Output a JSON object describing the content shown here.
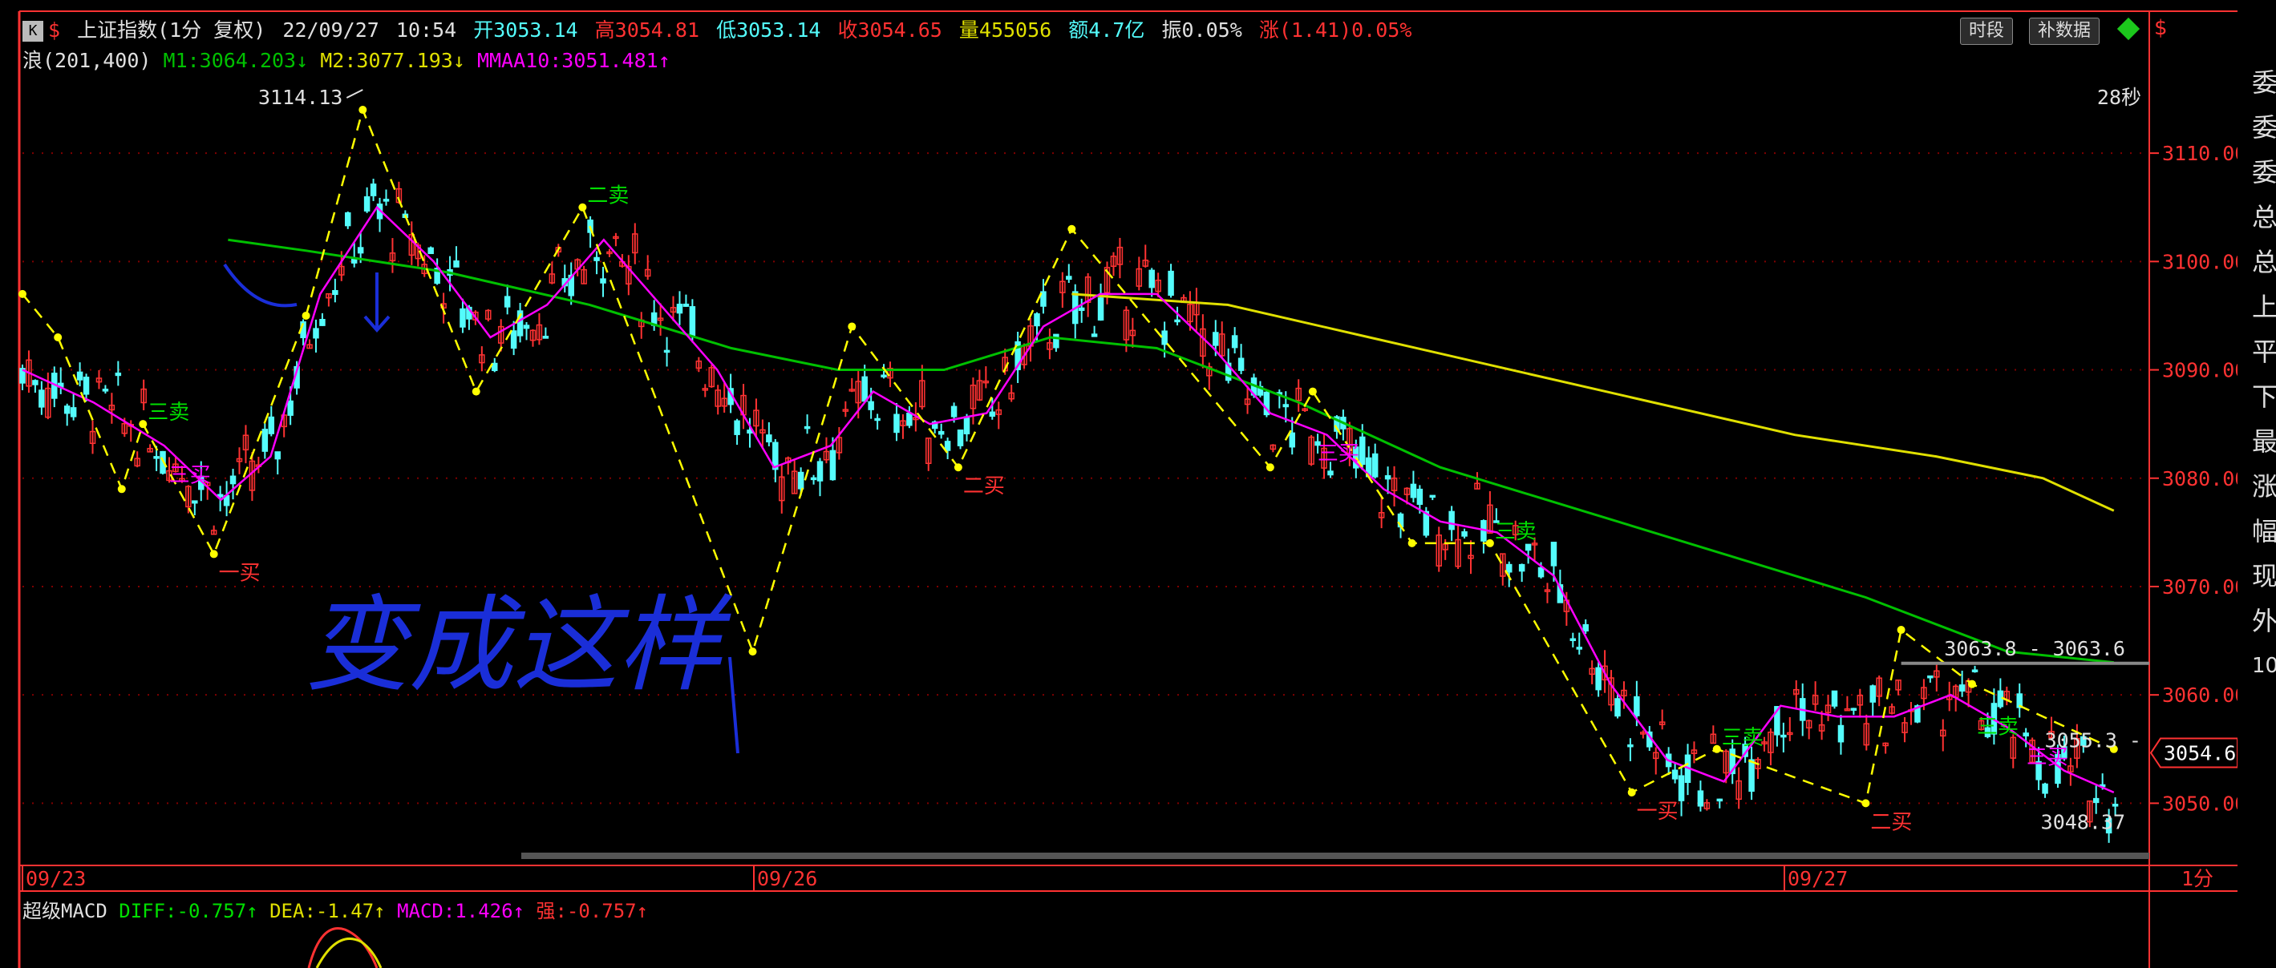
{
  "header": {
    "k_label": "K",
    "dollar": "$",
    "title": "上证指数(1分 复权)",
    "date": "22/09/27",
    "time": "10:54",
    "open": "开3053.14",
    "high": "高3054.81",
    "low": "低3053.14",
    "close": "收3054.65",
    "volume": "量455056",
    "amount": "额4.7亿",
    "amplitude": "振0.05%",
    "change": "涨(1.41)0.05%",
    "btn_period": "时段",
    "btn_fill": "补数据"
  },
  "indicators": {
    "wave": "浪(201,400)",
    "m1": "M1:3064.203",
    "m2": "M2:3077.193",
    "mmaa": "MMAA10:3051.481"
  },
  "macd": {
    "name": "超级MACD",
    "diff": "DIFF:-0.757",
    "dea": "DEA:-1.47",
    "macd": "MACD:1.426",
    "strong": "强:-0.757"
  },
  "right_panel_chars": [
    "委",
    "委",
    "委",
    "总",
    "总",
    "上",
    "平",
    "下",
    "最",
    "涨",
    "幅",
    "现",
    "外",
    "10"
  ],
  "chart_data": {
    "type": "line",
    "title": "上证指数(1分 复权)",
    "interval": "1分",
    "x_labels": [
      "09/23",
      "09/26",
      "09/27"
    ],
    "y_ticks": [
      3050,
      3060,
      3070,
      3080,
      3090,
      3100,
      3110
    ],
    "y_tick_labels": [
      "3050.00",
      "3060.00",
      "3070.00",
      "3080.00",
      "3090.00",
      "3100.00",
      "3110.00"
    ],
    "ylim": [
      3045,
      3116
    ],
    "last_price": 3054.65,
    "last_price_label": "3054.65",
    "timer": "28秒",
    "annotations": {
      "high_label": "3114.13",
      "low_label": "3048.37",
      "right_high": "3063.8 - 3063.6",
      "right_mid": "3055.3 -",
      "handwriting": "变成这样"
    },
    "wave_points": [
      {
        "x": 0,
        "y": 3097
      },
      {
        "x": 5,
        "y": 3093
      },
      {
        "x": 14,
        "y": 3079
      },
      {
        "x": 17,
        "y": 3085
      },
      {
        "x": 27,
        "y": 3073
      },
      {
        "x": 40,
        "y": 3095
      },
      {
        "x": 48,
        "y": 3114
      },
      {
        "x": 64,
        "y": 3088
      },
      {
        "x": 79,
        "y": 3105
      },
      {
        "x": 103,
        "y": 3064
      },
      {
        "x": 117,
        "y": 3094
      },
      {
        "x": 132,
        "y": 3081
      },
      {
        "x": 148,
        "y": 3103
      },
      {
        "x": 176,
        "y": 3081
      },
      {
        "x": 182,
        "y": 3088
      },
      {
        "x": 196,
        "y": 3074
      },
      {
        "x": 207,
        "y": 3074
      },
      {
        "x": 227,
        "y": 3051
      },
      {
        "x": 239,
        "y": 3055
      },
      {
        "x": 260,
        "y": 3050
      },
      {
        "x": 265,
        "y": 3066
      },
      {
        "x": 275,
        "y": 3061
      },
      {
        "x": 295,
        "y": 3055
      }
    ],
    "signals": [
      {
        "x": 17,
        "y": 3085,
        "text": "三卖"
      },
      {
        "x": 20,
        "y": 3082,
        "text": "三买"
      },
      {
        "x": 27,
        "y": 3073,
        "text": "一买"
      },
      {
        "x": 79,
        "y": 3105,
        "text": "二卖"
      },
      {
        "x": 132,
        "y": 3081,
        "text": "二买"
      },
      {
        "x": 182,
        "y": 3084,
        "text": "三买"
      },
      {
        "x": 207,
        "y": 3074,
        "text": "三卖"
      },
      {
        "x": 227,
        "y": 3051,
        "text": "一买"
      },
      {
        "x": 239,
        "y": 3055,
        "text": "三卖"
      },
      {
        "x": 260,
        "y": 3050,
        "text": "二买"
      },
      {
        "x": 275,
        "y": 3056,
        "text": "三卖"
      },
      {
        "x": 282,
        "y": 3056,
        "text": "三买"
      }
    ],
    "m1_series": [
      [
        29,
        3102
      ],
      [
        40,
        3101
      ],
      [
        60,
        3099
      ],
      [
        80,
        3096
      ],
      [
        100,
        3092
      ],
      [
        115,
        3090
      ],
      [
        130,
        3090
      ],
      [
        145,
        3093
      ],
      [
        160,
        3092
      ],
      [
        180,
        3087
      ],
      [
        200,
        3081
      ],
      [
        220,
        3077
      ],
      [
        240,
        3073
      ],
      [
        260,
        3069
      ],
      [
        280,
        3064
      ],
      [
        295,
        3063
      ]
    ],
    "m2_series": [
      [
        148,
        3097
      ],
      [
        170,
        3096
      ],
      [
        190,
        3093
      ],
      [
        210,
        3090
      ],
      [
        230,
        3087
      ],
      [
        250,
        3084
      ],
      [
        270,
        3082
      ],
      [
        285,
        3080
      ],
      [
        295,
        3077
      ]
    ],
    "mmaa_series": [
      [
        0,
        3090
      ],
      [
        10,
        3087
      ],
      [
        20,
        3083
      ],
      [
        28,
        3078
      ],
      [
        35,
        3082
      ],
      [
        42,
        3097
      ],
      [
        50,
        3105
      ],
      [
        58,
        3100
      ],
      [
        66,
        3093
      ],
      [
        74,
        3096
      ],
      [
        82,
        3102
      ],
      [
        90,
        3096
      ],
      [
        98,
        3090
      ],
      [
        106,
        3081
      ],
      [
        114,
        3083
      ],
      [
        120,
        3088
      ],
      [
        128,
        3085
      ],
      [
        136,
        3086
      ],
      [
        144,
        3094
      ],
      [
        152,
        3097
      ],
      [
        160,
        3097
      ],
      [
        168,
        3092
      ],
      [
        176,
        3086
      ],
      [
        184,
        3084
      ],
      [
        192,
        3079
      ],
      [
        200,
        3076
      ],
      [
        208,
        3075
      ],
      [
        216,
        3071
      ],
      [
        224,
        3061
      ],
      [
        232,
        3054
      ],
      [
        240,
        3052
      ],
      [
        248,
        3059
      ],
      [
        256,
        3058
      ],
      [
        264,
        3058
      ],
      [
        272,
        3060
      ],
      [
        280,
        3057
      ],
      [
        288,
        3053
      ],
      [
        295,
        3051
      ]
    ],
    "macd_indicator": {
      "diff": -0.757,
      "dea": -1.47,
      "macd": 1.426,
      "strong": -0.757
    }
  },
  "colors": {
    "up": "#ff3232",
    "down": "#54fcfc",
    "wave": "#ffff00",
    "m1": "#00c000",
    "m2": "#e0e000",
    "mmaa": "#ff00ff",
    "grid": "#800000",
    "handwriting": "#1a2ed8"
  }
}
